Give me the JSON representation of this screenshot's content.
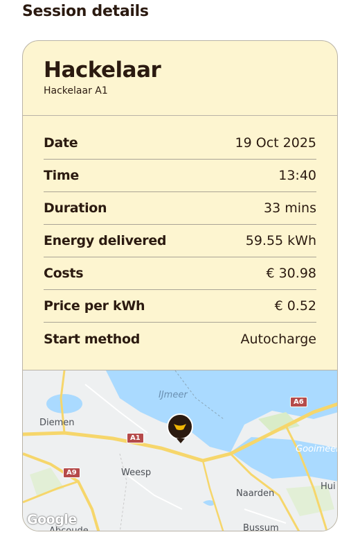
{
  "page": {
    "title": "Session details"
  },
  "location": {
    "name": "Hackelaar",
    "charger": "Hackelaar A1"
  },
  "details": [
    {
      "label": "Date",
      "value": "19 Oct 2025"
    },
    {
      "label": "Time",
      "value": "13:40"
    },
    {
      "label": "Duration",
      "value": "33 mins"
    },
    {
      "label": "Energy delivered",
      "value": "59.55 kWh"
    },
    {
      "label": "Costs",
      "value": "€ 30.98"
    },
    {
      "label": "Price per kWh",
      "value": "€ 0.52"
    },
    {
      "label": "Start method",
      "value": "Autocharge"
    }
  ],
  "map": {
    "places": [
      "Diemen",
      "Weesp",
      "Naarden",
      "Bussum",
      "Huizen",
      "Abcoude",
      "IJmeer",
      "Gooimeer"
    ],
    "places_partial": [
      "Hui",
      "Abcoude"
    ],
    "roads": [
      "A1",
      "A6",
      "A9"
    ],
    "attribution": "Google",
    "pin_icon": "charging-station-pin-icon"
  },
  "colors": {
    "card_background": "#fdf5d0",
    "text": "#2b1a10",
    "pin": "#2b1a10",
    "pin_accent": "#f2b705",
    "map_water": "#aadaff",
    "map_road": "#f6d66b",
    "road_shield": "#b54a4a"
  }
}
